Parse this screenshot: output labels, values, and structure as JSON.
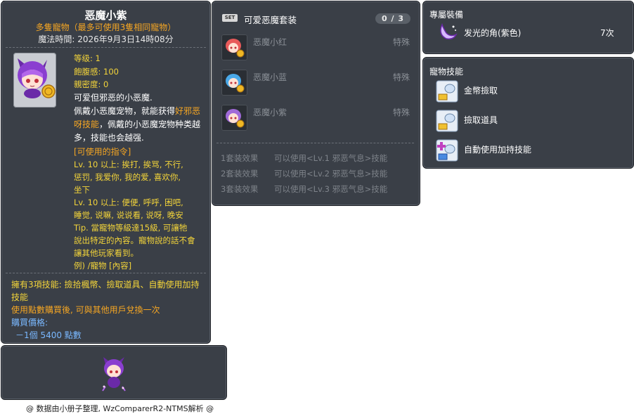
{
  "item_id": "05000298",
  "item": {
    "name": "恶魔小紫",
    "subtitle": "多隻寵物（最多可使用3隻相同寵物）",
    "magic_time": "魔法時間: 2026年9月3日14時08分",
    "stats": [
      "等级: 1",
      "飽腹感: 100",
      "親密度: 0"
    ],
    "desc_lines": [
      "可爱但邪恶的小恶魔.",
      "佩戴小恶魔宠物，就能获得",
      "好邪恶",
      "呀技能",
      "，佩戴的小恶魔宠物种类越",
      "多，技能也会越强."
    ],
    "command_header": "[可使用的指令]",
    "command_lines": [
      "Lv. 10 以上:  挨打, 挨骂, 不行,",
      "惩罚, 我爱你, 我的爱, 喜欢你,",
      "坐下",
      "Lv. 10 以上:  便便, 呼呼, 困吧,",
      "睡觉, 说嘛, 说说看, 说呀, 晚安"
    ],
    "tip_lines": [
      "Tip. 當寵物等級達15級, 可讓牠",
      "說出特定的內容。寵物說的話不會",
      "讓其他玩家看到。",
      "例) /寵物 [內容]"
    ],
    "skills_line1": "擁有3項技能: 撿拾楓幣、撿取道具、自動使用加持",
    "skills_line2": "技能",
    "exchange_note": "使用點數購買後, 可與其他用戶兌換一次",
    "price_label": "購買價格:",
    "price_value": "－1個 5400 點數"
  },
  "set": {
    "badge": "SET",
    "title": "可爱恶魔套装",
    "count": "0 / 3",
    "items": [
      {
        "name": "恶魔小红",
        "type": "特殊",
        "color": "#e85a5a"
      },
      {
        "name": "恶魔小蓝",
        "type": "特殊",
        "color": "#4aa9e8"
      },
      {
        "name": "恶魔小紫",
        "type": "特殊",
        "color": "#a06ad8"
      }
    ],
    "effects": [
      {
        "label": "1套装效果",
        "text": "可以使用<Lv.1 邪恶气息>技能"
      },
      {
        "label": "2套装效果",
        "text": "可以使用<Lv.2 邪恶气息>技能"
      },
      {
        "label": "3套装效果",
        "text": "可以使用<Lv.3 邪恶气息>技能"
      }
    ]
  },
  "exclusive": {
    "header": "專屬裝備",
    "item_name": "发光的角(紫色)",
    "item_count": "7次"
  },
  "pet_skills": {
    "header": "寵物技能",
    "skills": [
      "金幣撿取",
      "撿取道具",
      "自動使用加持技能"
    ]
  },
  "footer": "@ 数据由小册子整理, WzComparerR2-NTMS解析 @",
  "colors": {
    "panel_bg": "#3a3f47",
    "highlight_orange": "#f5a623",
    "stat_yellow": "#f3d43a",
    "dim_text": "#8a8f96",
    "character_purple": "#a06ad8"
  }
}
